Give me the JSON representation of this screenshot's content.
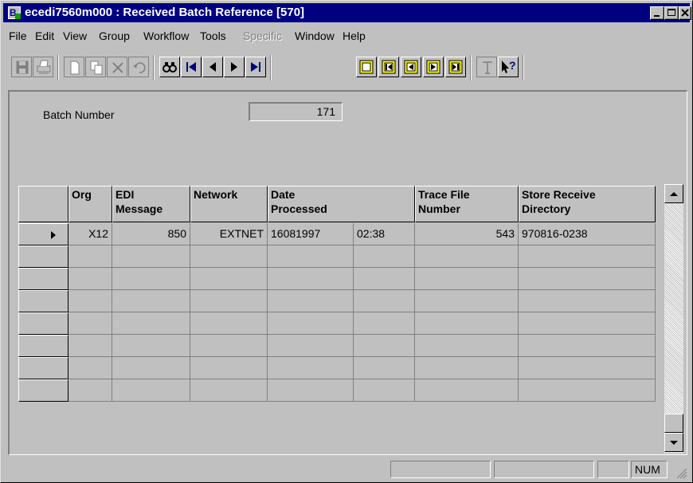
{
  "window": {
    "title": "ecedi7560m000 : Received Batch Reference [570]",
    "app_icon_letter": "B"
  },
  "menu": {
    "items": [
      "File",
      "Edit",
      "View",
      "Group",
      "Workflow",
      "Tools",
      "Specific",
      "Window",
      "Help"
    ],
    "disabled": [
      "Specific"
    ]
  },
  "toolbar": {
    "buttons": [
      "save-icon",
      "print-icon",
      "new-document-icon",
      "copy-icon",
      "delete-icon",
      "undo-icon",
      "find-icon",
      "first-record-icon",
      "previous-record-icon",
      "next-record-icon",
      "last-record-icon",
      "group-icon",
      "group-first-icon",
      "group-previous-icon",
      "group-next-icon",
      "group-last-icon",
      "text-icon",
      "help-pointer-icon"
    ]
  },
  "form": {
    "batch_label": "Batch Number",
    "batch_value": "171"
  },
  "grid": {
    "headers": {
      "org": "Org",
      "edi_message": "EDI\nMessage",
      "network": "Network",
      "date_processed": "Date\nProcessed",
      "trace_file_number": "Trace File\nNumber",
      "store_receive_directory": "Store Receive\nDirectory"
    },
    "rows": [
      {
        "org": "X12",
        "edi_message": "850",
        "network": "EXTNET",
        "date": "16081997",
        "time": "02:38",
        "trace_file_number": "543",
        "store_receive_directory": "970816-0238",
        "current": true
      }
    ],
    "empty_rows": 7
  },
  "statusbar": {
    "num_indicator": "NUM"
  }
}
